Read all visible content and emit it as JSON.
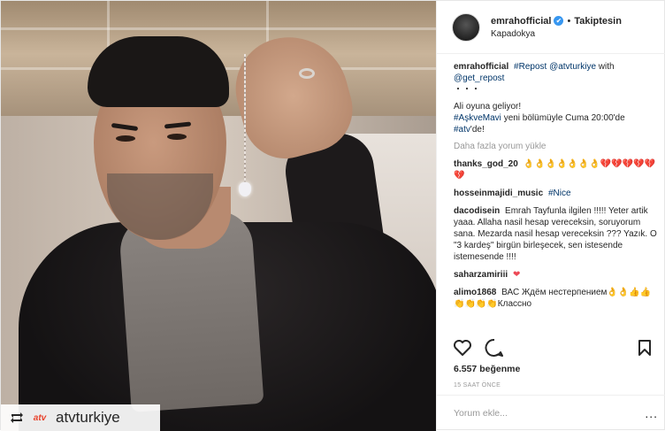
{
  "post": {
    "username": "emrahofficial",
    "verified_badge": "✔",
    "separator": "•",
    "follow_state": "Takiptesin",
    "location": "Kapadokya"
  },
  "image": {
    "repost_handle": "atvturkiye",
    "atv_logo_text": "atv"
  },
  "caption": {
    "user": "emrahofficial",
    "tag1": "#Repost",
    "mention": "@atvturkiye",
    "text1": "with",
    "mention2": "@get_repost",
    "dots": "・・・",
    "line1": "Ali oyuna geliyor!",
    "hashtag": "#AşkveMavi",
    "line2": "yeni bölümüyle Cuma 20:00'de",
    "hashtag2": "#atv",
    "line3": "'de!"
  },
  "load_more": "Daha fazla yorum yükle",
  "comments": [
    {
      "user": "thanks_god_20",
      "text": "👌👌👌👌👌👌👌💔💔💔💔💔💔"
    },
    {
      "user": "hosseinmajidi_music",
      "text": "#Nice"
    },
    {
      "user": "dacodisein",
      "text": "Emrah Tayfunla ilgilen !!!!! Yeter artik yaaa. Allaha nasil hesap vereceksin, soruyorum sana. Mezarda nasil hesap vereceksin ??? Yazık. O \"3 kardeş\" birgün birleşecek, sen istesende istemesende !!!!"
    },
    {
      "user": "saharzamiriii",
      "text": "❤"
    },
    {
      "user": "alimo1868",
      "text": "ВАС Ждём нестерпением👌👌👍👍👏👏👏👏Классно"
    }
  ],
  "actions": {
    "like_icon": "heart-icon",
    "comment_icon": "comment-icon",
    "save_icon": "bookmark-icon"
  },
  "likes": "6.557 beğenme",
  "timestamp": "15 SAAT ÖNCE",
  "add_comment": {
    "placeholder": "Yorum ekle...",
    "more_label": "..."
  },
  "colors": {
    "link": "#003569",
    "verified": "#3897f0",
    "muted": "#999999",
    "text": "#262626"
  }
}
